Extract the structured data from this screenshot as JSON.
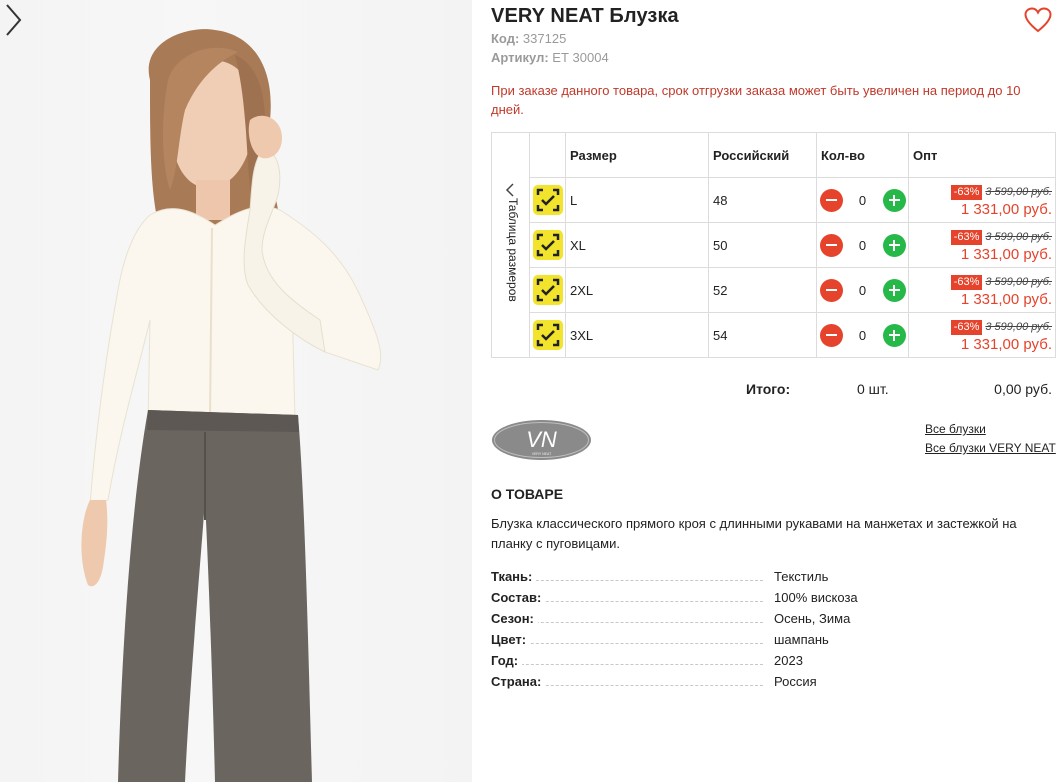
{
  "product": {
    "title": "VERY NEAT Блузка",
    "code_label": "Код:",
    "code": "337125",
    "article_label": "Артикул:",
    "article": "ЕТ 30004",
    "warning": "При заказе данного товара, срок отгрузки заказа может быть увеличен на период до 10 дней."
  },
  "size_table": {
    "side_label": "Таблица размеров",
    "headers": {
      "size": "Размер",
      "russian": "Российский",
      "qty": "Кол-во",
      "price": "Опт"
    },
    "rows": [
      {
        "size": "L",
        "russian": "48",
        "qty": "0",
        "discount": "-63%",
        "old_price": "3 599,00 руб.",
        "price": "1 331,00 руб."
      },
      {
        "size": "XL",
        "russian": "50",
        "qty": "0",
        "discount": "-63%",
        "old_price": "3 599,00 руб.",
        "price": "1 331,00 руб."
      },
      {
        "size": "2XL",
        "russian": "52",
        "qty": "0",
        "discount": "-63%",
        "old_price": "3 599,00 руб.",
        "price": "1 331,00 руб."
      },
      {
        "size": "3XL",
        "russian": "54",
        "qty": "0",
        "discount": "-63%",
        "old_price": "3 599,00 руб.",
        "price": "1 331,00 руб."
      }
    ]
  },
  "total": {
    "label": "Итого:",
    "qty": "0 шт.",
    "sum": "0,00 руб."
  },
  "brand": {
    "logo_text": "VN",
    "logo_sub": "VERY NEAT"
  },
  "links": {
    "all_blouses": "Все блузки",
    "all_brand_blouses": "Все блузки VERY NEAT"
  },
  "about": {
    "heading": "О ТОВАРЕ",
    "text": "Блузка классического прямого кроя с длинными рукавами на манжетах и застежкой на планку с пуговицами.",
    "properties": [
      {
        "key": "Ткань:",
        "value": "Текстиль"
      },
      {
        "key": "Состав:",
        "value": "100% вискоза"
      },
      {
        "key": "Сезон:",
        "value": "Осень, Зима"
      },
      {
        "key": "Цвет:",
        "value": "шампань"
      },
      {
        "key": "Год:",
        "value": "2023"
      },
      {
        "key": "Страна:",
        "value": "Россия"
      }
    ]
  },
  "colors": {
    "accent_red": "#e5432b",
    "plus_green": "#27b84a",
    "check_yellow": "#f2e42c",
    "warning_text": "#c0392b"
  },
  "icons": {
    "favorite": "heart-outline-icon",
    "next": "chevron-right-icon",
    "size_table": "chevron-left-icon",
    "available": "check-scan-icon"
  }
}
